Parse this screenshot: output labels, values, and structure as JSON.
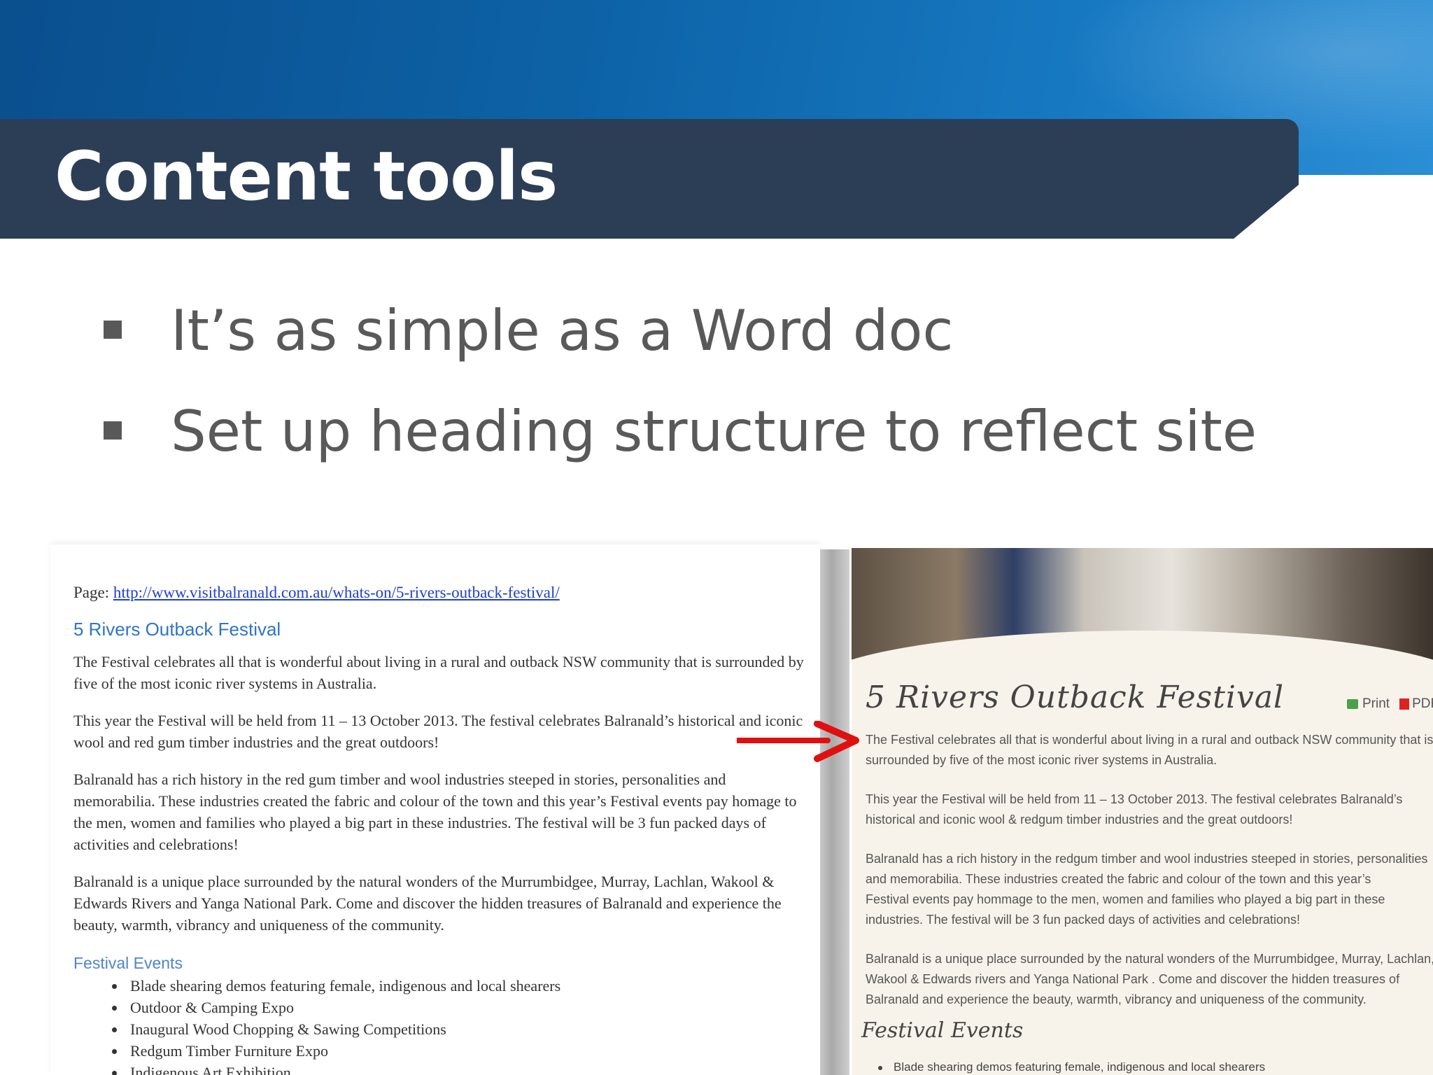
{
  "slide": {
    "title": "Content tools",
    "bullets": [
      "It’s as simple as a Word doc",
      "Set up heading structure to reflect site"
    ]
  },
  "word_doc": {
    "page_label": "Page:",
    "page_url": "http://www.visitbalranald.com.au/whats-on/5-rivers-outback-festival/",
    "heading": "5 Rivers Outback Festival",
    "paragraphs": [
      "The Festival celebrates all that is wonderful about living in a rural and outback NSW community that is surrounded by five of the most iconic river systems in Australia.",
      "This year the Festival will be held from 11 – 13 October 2013. The festival celebrates Balranald’s historical and iconic wool and red gum timber industries and the great outdoors!",
      "Balranald has a rich history in the red gum timber and wool industries steeped in stories, personalities and memorabilia.  These industries created the fabric and colour of the town and this year’s Festival events pay homage to the men, women and families who played a big part in these industries. The festival will be 3 fun packed days of activities and celebrations!",
      "Balranald is a unique place surrounded by the natural wonders of the Murrumbidgee, Murray, Lachlan, Wakool & Edwards Rivers and Yanga National Park. Come and discover the hidden treasures of Balranald and experience the beauty, warmth, vibrancy and uniqueness of the community."
    ],
    "events_heading": "Festival Events",
    "events": [
      "Blade shearing demos featuring female, indigenous and local shearers",
      "Outdoor & Camping Expo",
      "Inaugural Wood Chopping & Sawing Competitions",
      "Redgum Timber Furniture Expo",
      "Indigenous Art Exhibition"
    ]
  },
  "website": {
    "heading": "5 Rivers Outback Festival",
    "print_label": "Print",
    "pdf_label": "PDF",
    "lines": [
      "The Festival celebrates all that is wonderful about living in a rural and outback NSW community that is",
      "surrounded by five of the most iconic river systems in Australia.",
      "This year the Festival will be held from 11 – 13 October 2013. The festival celebrates Balranald’s",
      "historical and iconic wool & redgum timber industries and the great outdoors!",
      "Balranald has a rich history in the redgum timber and wool industries steeped in stories,  personalities",
      "and memorabilia.  These industries created the fabric and colour of the town and this year’s",
      "Festival events pay hommage to the men, women and families who played a big part in these",
      "industries. The festival will  be 3 fun packed days of activities and celebrations!",
      "Balranald is a unique place surrounded by the natural wonders of the Murrumbidgee, Murray, Lachlan,",
      "Wakool & Edwards rivers and Yanga National Park . Come and discover the hidden treasures of",
      "Balranald and experience the beauty, warmth, vibrancy and uniqueness of  the community."
    ],
    "events_heading": "Festival Events",
    "first_event": "Blade shearing demos featuring female, indigenous and local shearers"
  },
  "colors": {
    "title_bar": "#2c3e56",
    "top_band": "#0d62a6",
    "body_text": "#595959",
    "link": "#1f3fd0",
    "heading_blue": "#2f75c5",
    "arrow": "#e01010"
  }
}
